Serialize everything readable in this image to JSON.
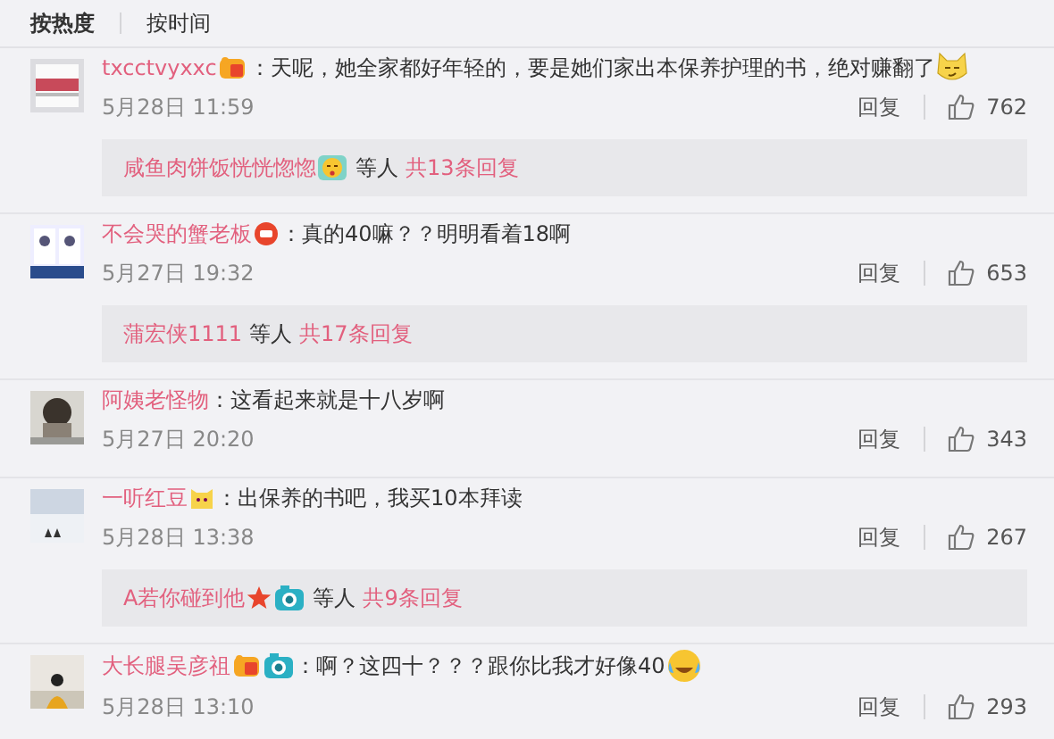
{
  "sort_tabs": [
    {
      "label": "按热度",
      "selected": true
    },
    {
      "label": "按时间",
      "selected": false
    }
  ],
  "comments": [
    {
      "author": "txcctvyxxc",
      "author_icons": [
        {
          "kind": "vip"
        }
      ],
      "text": "：天呢，她全家都好年轻的，要是她们家出本保养护理的书，绝对赚翻了",
      "end_icon": {
        "kind": "cat-smirk"
      },
      "time": "5月28日 11:59",
      "reply_label": "回复",
      "likes": "762",
      "replies": {
        "names": [
          {
            "name": "咸鱼肉饼饭恍恍惚惚",
            "icons": [
              {
                "kind": "wink"
              }
            ]
          }
        ],
        "etc": "等人",
        "count": "共13条回复"
      }
    },
    {
      "author": "不会哭的蟹老板",
      "author_icons": [
        {
          "kind": "fan"
        }
      ],
      "text": "：真的40嘛？？明明看着18啊",
      "time": "5月27日 19:32",
      "reply_label": "回复",
      "likes": "653",
      "replies": {
        "names": [
          {
            "name": "蒲宏侠1111"
          }
        ],
        "etc": "等人",
        "count": "共17条回复"
      }
    },
    {
      "author": "阿姨老怪物",
      "text": "：这看起来就是十八岁啊",
      "time": "5月27日 20:20",
      "reply_label": "回复",
      "likes": "343"
    },
    {
      "author": "一听红豆",
      "author_icons": [
        {
          "kind": "cat"
        }
      ],
      "text": "：出保养的书吧，我买10本拜读",
      "time": "5月28日 13:38",
      "reply_label": "回复",
      "likes": "267",
      "replies": {
        "names": [
          {
            "name": "A若你碰到他",
            "icons": [
              {
                "kind": "star"
              },
              {
                "kind": "camera"
              }
            ]
          }
        ],
        "etc": "等人",
        "count": "共9条回复"
      }
    },
    {
      "author": "大长腿吴彦祖",
      "author_icons": [
        {
          "kind": "vip"
        },
        {
          "kind": "camera"
        }
      ],
      "text": "：啊？这四十？？？跟你比我才好像40",
      "end_icon": {
        "kind": "laugh-cry"
      },
      "time": "5月28日 13:10",
      "reply_label": "回复",
      "likes": "293"
    }
  ]
}
